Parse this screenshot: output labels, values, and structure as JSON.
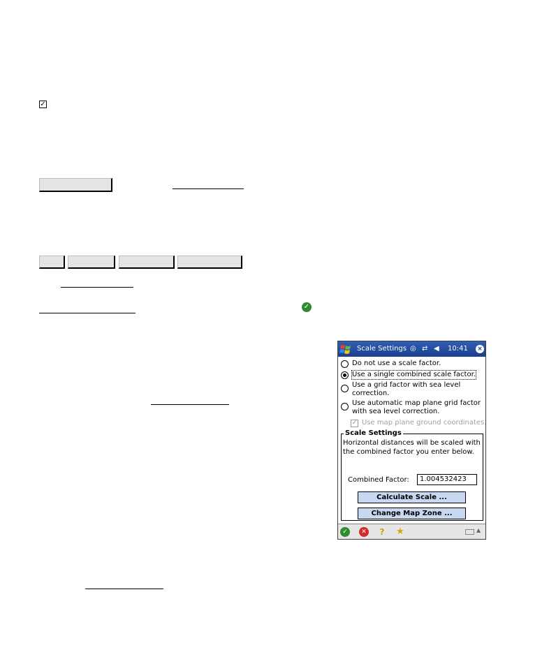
{
  "document": {
    "checkbox_glyph": "✓"
  },
  "pda": {
    "title": "Scale Settings",
    "clock": "10:41",
    "status_icons": [
      "sync-icon",
      "connectivity-icon",
      "volume-icon"
    ],
    "close_glyph": "×",
    "options": [
      {
        "label": "Do not use a scale factor.",
        "selected": false
      },
      {
        "label": "Use a single combined scale factor.",
        "selected": true
      },
      {
        "label": "Use a grid factor with sea level correction.",
        "selected": false
      },
      {
        "label": "Use automatic map plane grid factor with sea level correction.",
        "selected": false
      }
    ],
    "use_map_plane": {
      "label": "Use map plane ground coordinates.",
      "checked": true,
      "disabled": true
    },
    "group": {
      "title": "Scale Settings",
      "description": "Horizontal distances will be scaled with the combined factor you enter below.",
      "combined_factor_label": "Combined Factor:",
      "combined_factor_value": "1.004532423",
      "calculate_button": "Calculate Scale ...",
      "change_zone_button": "Change Map Zone ..."
    },
    "toolbar": {
      "ok_glyph": "✓",
      "cancel_glyph": "✕",
      "help_glyph": "?",
      "favorite_glyph": "★"
    },
    "colors": {
      "titlebar": "#1b3f8e",
      "button": "#c8d8f0",
      "ok": "#2e8b2e",
      "cancel": "#d42a2a"
    }
  }
}
